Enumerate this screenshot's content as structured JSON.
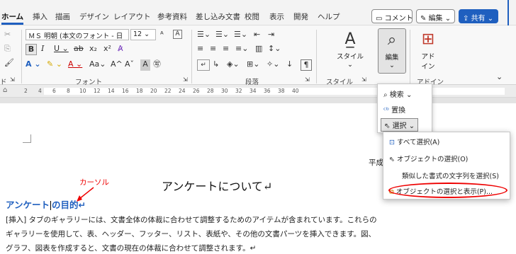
{
  "tabs": [
    "ホーム",
    "挿入",
    "描画",
    "デザイン",
    "レイアウト",
    "参考資料",
    "差し込み文書",
    "校閲",
    "表示",
    "開発",
    "ヘルプ"
  ],
  "top_buttons": {
    "comment": "コメント",
    "edit": "編集",
    "share": "共有"
  },
  "ribbon": {
    "font_name": "ＭＳ 明朝 (本文のフォント - 日",
    "font_size": "12",
    "groups": {
      "font": "フォント",
      "paragraph": "段落",
      "style": "スタイル",
      "addin": "アドイン",
      "clipboard": "ド"
    },
    "style_btn": "スタイル",
    "edit_btn": "編集",
    "addin_btn_line1": "アド",
    "addin_btn_line2": "イン"
  },
  "ruler_ticks": [
    "2",
    "4",
    "6",
    "8",
    "10",
    "12",
    "14",
    "16",
    "18",
    "20",
    "22",
    "24",
    "26",
    "28",
    "30",
    "32",
    "34",
    "36",
    "38",
    "40"
  ],
  "edit_menu": {
    "find": "検索",
    "replace": "置換",
    "select": "選択"
  },
  "select_menu": [
    "すべて選択(A)",
    "オブジェクトの選択(O)",
    "類似した書式の文字列を選択(S)",
    "オブジェクトの選択と表示(P)..."
  ],
  "doc": {
    "partial_right": "平成",
    "cursor_label": "カーソル",
    "heading": "アンケートについて↵",
    "sub_heading_a": "アンケート",
    "sub_heading_b": "の目的↵",
    "lines": [
      "[挿入] タブのギャラリーには、文書全体の体裁に合わせて調整するためのアイテムが含まれています。これらの",
      "ギャラリーを使用して、表、ヘッダー、フッター、リスト、表紙や、その他の文書パーツを挿入できます。図、",
      "グラフ、図表を作成すると、文書の現在の体裁に合わせて調整されます。↵"
    ]
  },
  "colors": {
    "accent": "#1f5fbf",
    "annotation": "#e00000"
  }
}
